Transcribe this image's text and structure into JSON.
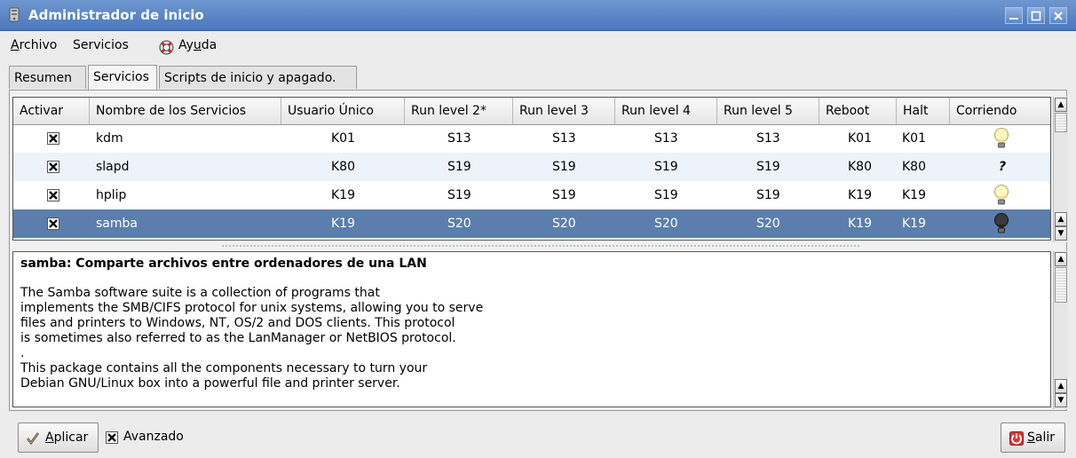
{
  "window": {
    "title": "Administrador de inicio",
    "buttons": [
      "minimize",
      "maximize",
      "close"
    ]
  },
  "menubar": {
    "archivo": "Archivo",
    "servicios": "Servicios",
    "ayuda": "Ayuda"
  },
  "tabs": [
    {
      "label": "Resumen",
      "active": false
    },
    {
      "label": "Servicios",
      "active": true
    },
    {
      "label": "Scripts de inicio y apagado.",
      "active": false
    }
  ],
  "table": {
    "headers": [
      "Activar",
      "Nombre de los Servicios",
      "Usuario Único",
      "Run level 2*",
      "Run level 3",
      "Run level 4",
      "Run level 5",
      "Reboot",
      "Halt",
      "Corriendo"
    ],
    "rows": [
      {
        "active": true,
        "name": "kdm",
        "unique": "K01",
        "rl2": "S13",
        "rl3": "S13",
        "rl4": "S13",
        "rl5": "S13",
        "reboot": "K01",
        "halt": "K01",
        "running": "bulb-on-icon",
        "selected": false
      },
      {
        "active": true,
        "name": "slapd",
        "unique": "K80",
        "rl2": "S19",
        "rl3": "S19",
        "rl4": "S19",
        "rl5": "S19",
        "reboot": "K80",
        "halt": "K80",
        "running": "unknown-icon",
        "running_text": "?",
        "selected": false
      },
      {
        "active": true,
        "name": "hplip",
        "unique": "K19",
        "rl2": "S19",
        "rl3": "S19",
        "rl4": "S19",
        "rl5": "S19",
        "reboot": "K19",
        "halt": "K19",
        "running": "bulb-on-icon",
        "selected": false
      },
      {
        "active": true,
        "name": "samba",
        "unique": "K19",
        "rl2": "S20",
        "rl3": "S20",
        "rl4": "S20",
        "rl5": "S20",
        "reboot": "K19",
        "halt": "K19",
        "running": "bulb-off-icon",
        "selected": true
      }
    ]
  },
  "description": {
    "title": "samba: Comparte archivos entre ordenadores de una LAN",
    "lines": [
      "The Samba software suite is a collection of programs that",
      "implements the SMB/CIFS protocol for unix systems, allowing you to serve",
      "files and printers to Windows, NT, OS/2 and DOS clients. This protocol",
      "is sometimes also referred to as the LanManager or NetBIOS protocol.",
      ".",
      "This package contains all the components necessary to turn your",
      "Debian GNU/Linux box into a powerful file and printer server."
    ]
  },
  "footer": {
    "apply": "Aplicar",
    "advanced": "Avanzado",
    "advanced_checked": true,
    "exit": "Salir"
  },
  "colors": {
    "titlebar": "#4a78bd",
    "selection": "#5b7eac",
    "alt_row": "#edf3fb"
  }
}
